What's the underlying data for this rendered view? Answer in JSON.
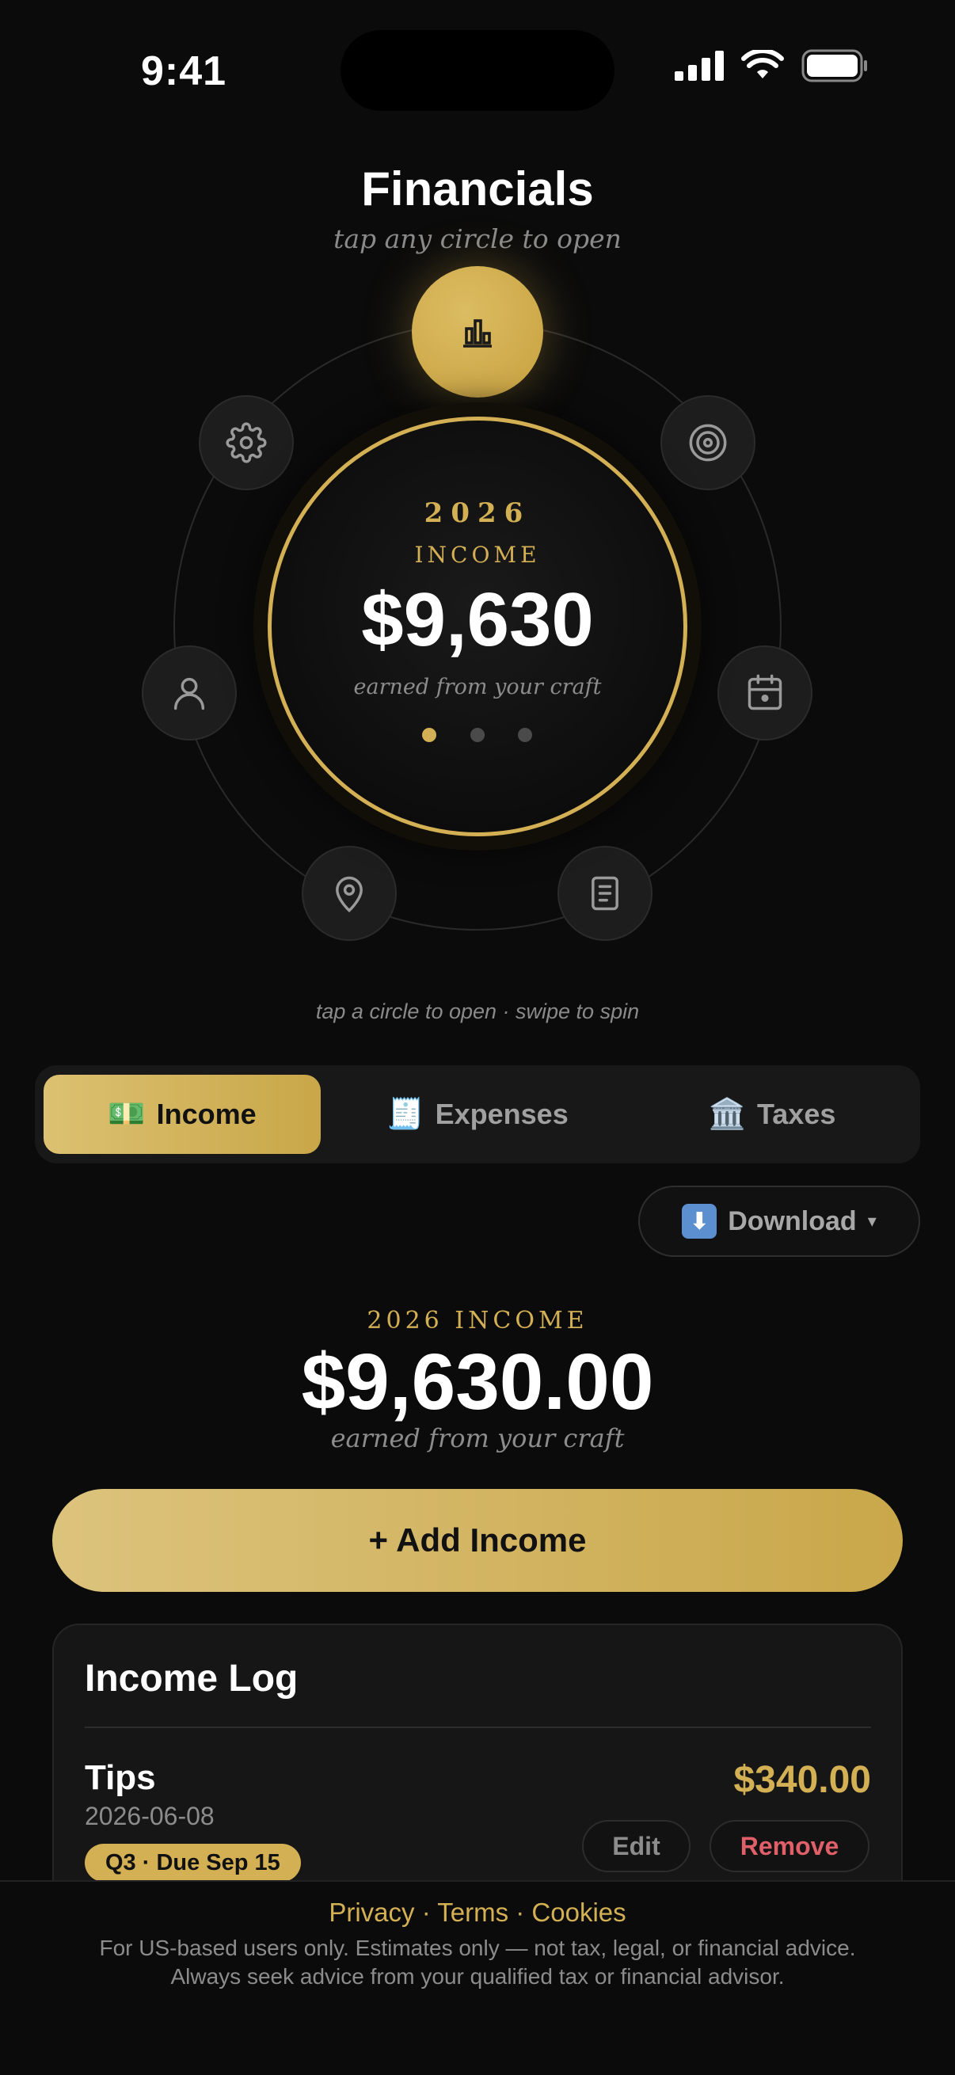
{
  "status": {
    "time": "9:41"
  },
  "header": {
    "title": "Financials",
    "subtitle": "tap any circle to open"
  },
  "orbit": {
    "top_icon": "bar-chart-icon",
    "icons": [
      "settings-icon",
      "target-icon",
      "person-icon",
      "calendar-icon",
      "location-pin-icon",
      "document-icon"
    ],
    "center": {
      "year": "2026",
      "label": "INCOME",
      "amount": "$9,630",
      "caption": "earned from your craft",
      "page_dots": 3,
      "active_dot": 0
    },
    "hint": "tap a circle to open · swipe to spin"
  },
  "tabs": [
    {
      "label": "Income",
      "icon": "💵",
      "active": true
    },
    {
      "label": "Expenses",
      "icon": "🧾",
      "active": false
    },
    {
      "label": "Taxes",
      "icon": "🏛️",
      "active": false
    }
  ],
  "download": {
    "label": "Download",
    "icon": "⬇",
    "chevron": "▾"
  },
  "summary": {
    "label": "2026 INCOME",
    "amount": "$9,630.00",
    "caption": "earned from your craft"
  },
  "add_button": {
    "label": "+ Add Income"
  },
  "income_log": {
    "title": "Income Log",
    "entries": [
      {
        "name": "Tips",
        "date": "2026-06-08",
        "badge": "Q3 · Due Sep 15",
        "amount": "$340.00",
        "edit_label": "Edit",
        "remove_label": "Remove"
      }
    ]
  },
  "footer": {
    "links": "Privacy · Terms · Cookies",
    "note_line1": "For US-based users only. Estimates only — not tax, legal, or financial advice.",
    "note_line2": "Always seek advice from your qualified tax or financial advisor."
  },
  "colors": {
    "gold": "#d4b055",
    "background": "#0b0b0b",
    "remove": "#e0606a"
  }
}
